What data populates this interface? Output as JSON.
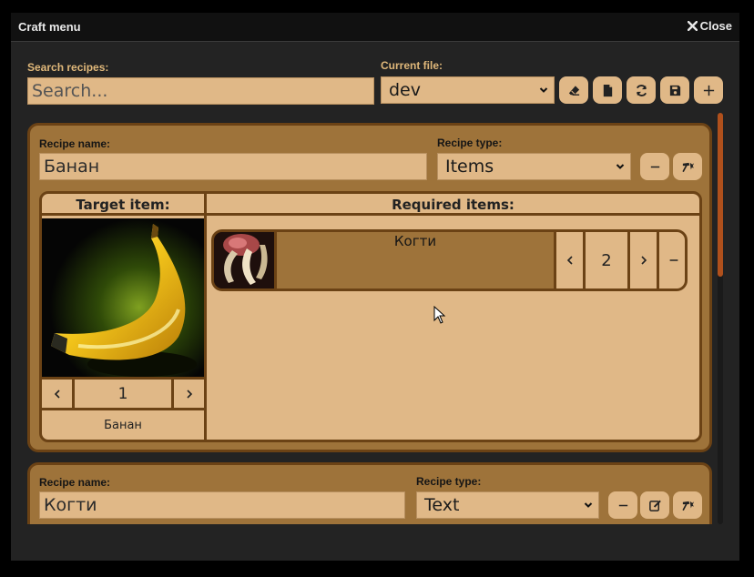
{
  "window": {
    "title": "Craft menu",
    "close_label": "Close"
  },
  "top": {
    "search_label": "Search recipes:",
    "search_placeholder": "Search...",
    "file_label": "Current file:",
    "file_value": "dev"
  },
  "recipes": [
    {
      "name_label": "Recipe name:",
      "name_value": "Банан",
      "type_label": "Recipe type:",
      "type_value": "Items",
      "target_header": "Target item:",
      "required_header": "Required items:",
      "target_count": "1",
      "target_name": "Банан",
      "required": [
        {
          "name": "Когти",
          "count": "2"
        }
      ]
    },
    {
      "name_label": "Recipe name:",
      "name_value": "Когти",
      "type_label": "Recipe type:",
      "type_value": "Text"
    }
  ],
  "colors": {
    "accent": "#e0b887",
    "card": "#9e733a",
    "border": "#6b4215",
    "label": "#e0b87a",
    "scroll_thumb": "#b0501c"
  }
}
